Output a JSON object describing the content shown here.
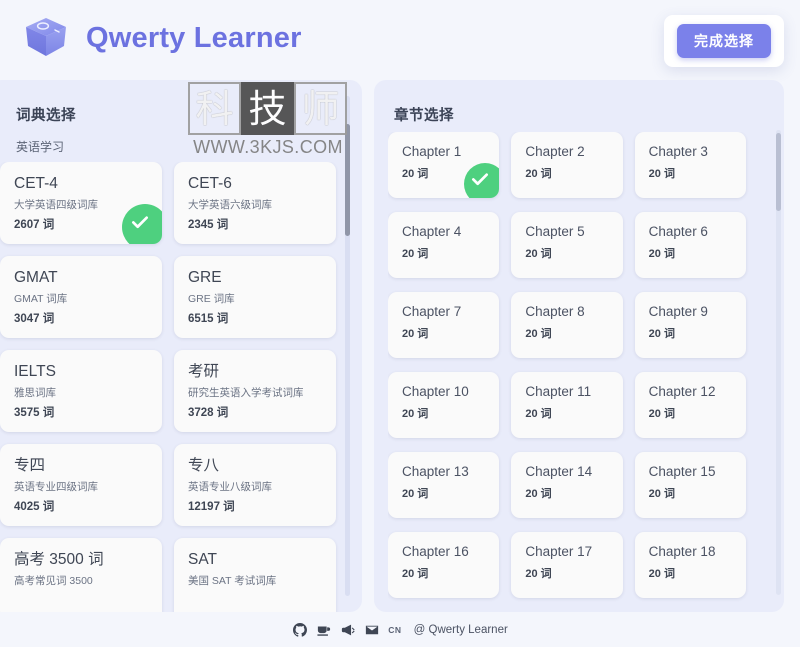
{
  "header": {
    "logo_icon": "keycap-icon",
    "title": "Qwerty Learner",
    "finish_button": "完成选择",
    "brand_color": "#6c72e0",
    "button_color": "#7b81ea"
  },
  "dictionary_panel": {
    "title": "词典选择",
    "category": "英语学习",
    "items": [
      {
        "name": "CET-4",
        "desc": "大学英语四级词库",
        "count": "2607 词",
        "selected": true
      },
      {
        "name": "CET-6",
        "desc": "大学英语六级词库",
        "count": "2345 词",
        "selected": false
      },
      {
        "name": "GMAT",
        "desc": "GMAT 词库",
        "count": "3047 词",
        "selected": false
      },
      {
        "name": "GRE",
        "desc": "GRE 词库",
        "count": "6515 词",
        "selected": false
      },
      {
        "name": "IELTS",
        "desc": "雅思词库",
        "count": "3575 词",
        "selected": false
      },
      {
        "name": "考研",
        "desc": "研究生英语入学考试词库",
        "count": "3728 词",
        "selected": false
      },
      {
        "name": "专四",
        "desc": "英语专业四级词库",
        "count": "4025 词",
        "selected": false
      },
      {
        "name": "专八",
        "desc": "英语专业八级词库",
        "count": "12197 词",
        "selected": false
      },
      {
        "name": "高考 3500 词",
        "desc": "高考常见词 3500",
        "count": "",
        "selected": false
      },
      {
        "name": "SAT",
        "desc": "美国 SAT 考试词库",
        "count": "",
        "selected": false
      }
    ]
  },
  "chapter_panel": {
    "title": "章节选择",
    "items": [
      {
        "name": "Chapter 1",
        "count": "20 词",
        "selected": true
      },
      {
        "name": "Chapter 2",
        "count": "20 词",
        "selected": false
      },
      {
        "name": "Chapter 3",
        "count": "20 词",
        "selected": false
      },
      {
        "name": "Chapter 4",
        "count": "20 词",
        "selected": false
      },
      {
        "name": "Chapter 5",
        "count": "20 词",
        "selected": false
      },
      {
        "name": "Chapter 6",
        "count": "20 词",
        "selected": false
      },
      {
        "name": "Chapter 7",
        "count": "20 词",
        "selected": false
      },
      {
        "name": "Chapter 8",
        "count": "20 词",
        "selected": false
      },
      {
        "name": "Chapter 9",
        "count": "20 词",
        "selected": false
      },
      {
        "name": "Chapter 10",
        "count": "20 词",
        "selected": false
      },
      {
        "name": "Chapter 11",
        "count": "20 词",
        "selected": false
      },
      {
        "name": "Chapter 12",
        "count": "20 词",
        "selected": false
      },
      {
        "name": "Chapter 13",
        "count": "20 词",
        "selected": false
      },
      {
        "name": "Chapter 14",
        "count": "20 词",
        "selected": false
      },
      {
        "name": "Chapter 15",
        "count": "20 词",
        "selected": false
      },
      {
        "name": "Chapter 16",
        "count": "20 词",
        "selected": false
      },
      {
        "name": "Chapter 17",
        "count": "20 词",
        "selected": false
      },
      {
        "name": "Chapter 18",
        "count": "20 词",
        "selected": false
      }
    ]
  },
  "selection": {
    "check_color": "#4ed07f"
  },
  "footer": {
    "icons": [
      "github-icon",
      "coffee-cup-icon",
      "megaphone-icon",
      "envelope-icon"
    ],
    "language": "CN",
    "copyright": "@ Qwerty Learner"
  },
  "watermark": {
    "chars": [
      "科",
      "技",
      "师"
    ],
    "url": "WWW.3KJS.COM"
  }
}
